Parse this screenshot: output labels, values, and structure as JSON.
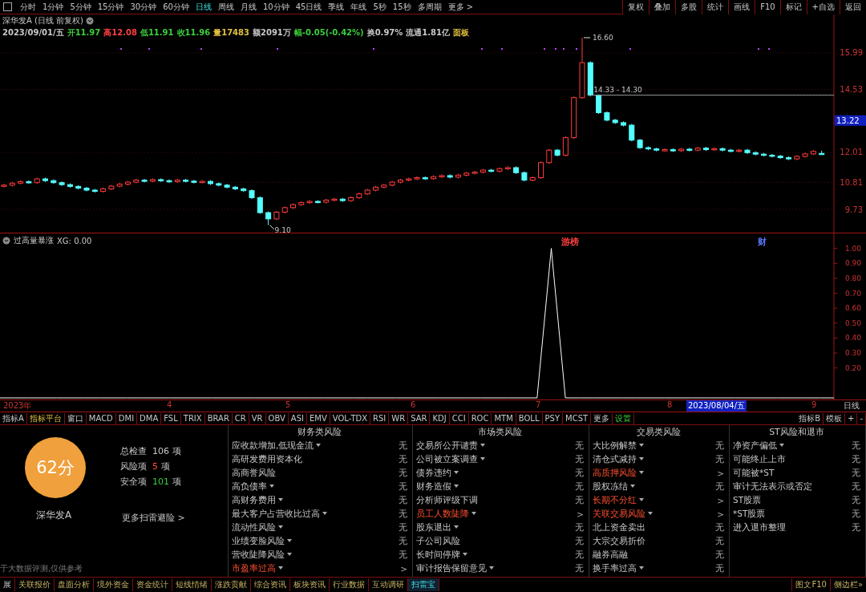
{
  "toolbar": {
    "periods": [
      {
        "label": "分时",
        "selected": false
      },
      {
        "label": "1分钟",
        "selected": false
      },
      {
        "label": "5分钟",
        "selected": false
      },
      {
        "label": "15分钟",
        "selected": false
      },
      {
        "label": "30分钟",
        "selected": false
      },
      {
        "label": "60分钟",
        "selected": false
      },
      {
        "label": "日线",
        "selected": true
      },
      {
        "label": "周线",
        "selected": false
      },
      {
        "label": "月线",
        "selected": false
      },
      {
        "label": "10分钟",
        "selected": false
      },
      {
        "label": "45日线",
        "selected": false
      },
      {
        "label": "季线",
        "selected": false
      },
      {
        "label": "年线",
        "selected": false
      },
      {
        "label": "5秒",
        "selected": false
      },
      {
        "label": "15秒",
        "selected": false
      },
      {
        "label": "多周期",
        "selected": false
      },
      {
        "label": "更多 >",
        "selected": false
      }
    ],
    "actions": [
      "复权",
      "叠加",
      "多股",
      "统计",
      "画线",
      "F10",
      "标记",
      "+自选",
      "返回"
    ]
  },
  "chart": {
    "title": "深华发A (日线 前复权)",
    "quote": [
      {
        "text": "2023/09/01/五",
        "color": "#c8c8c8"
      },
      {
        "text": "开11.97",
        "color": "#3ccd3c"
      },
      {
        "text": "高12.08",
        "color": "#ff4040"
      },
      {
        "text": "低11.91",
        "color": "#3ccd3c"
      },
      {
        "text": "收11.96",
        "color": "#3ccd3c"
      },
      {
        "text": "量17483",
        "color": "#e0c040"
      },
      {
        "text": "额2091万",
        "color": "#c8c8c8"
      },
      {
        "text": "幅-0.05(-0.42%)",
        "color": "#3ccd3c"
      },
      {
        "text": "换0.97%",
        "color": "#c8c8c8"
      },
      {
        "text": "流通1.81亿",
        "color": "#c8c8c8"
      },
      {
        "text": "面板",
        "color": "#e0c040"
      }
    ],
    "event_labels": [
      {
        "text": "游榜",
        "color": "#ff4040"
      },
      {
        "text": "财",
        "color": "#5a78ff"
      }
    ],
    "chart_data": {
      "type": "candlestick",
      "ylim": [
        8.8,
        17.53
      ],
      "yticks": [
        {
          "value": 15.99,
          "label": "15.99"
        },
        {
          "value": 14.53,
          "label": "14.53"
        },
        {
          "value": 12.01,
          "label": "12.01"
        },
        {
          "value": 10.81,
          "label": "10.81"
        },
        {
          "value": 9.73,
          "label": "9.73"
        }
      ],
      "grid": true,
      "annotations": [
        "16.60",
        "14.33 - 14.30",
        "9.10",
        "13.22"
      ],
      "ohlc": [
        [
          10.66,
          10.75,
          10.61,
          10.7
        ],
        [
          10.7,
          10.83,
          10.65,
          10.78
        ],
        [
          10.78,
          10.89,
          10.73,
          10.84
        ],
        [
          10.84,
          10.89,
          10.75,
          10.8
        ],
        [
          10.8,
          11.0,
          10.75,
          10.95
        ],
        [
          10.95,
          11.0,
          10.83,
          10.88
        ],
        [
          10.88,
          10.93,
          10.75,
          10.8
        ],
        [
          10.8,
          10.85,
          10.67,
          10.72
        ],
        [
          10.72,
          10.77,
          10.6,
          10.65
        ],
        [
          10.65,
          10.7,
          10.53,
          10.58
        ],
        [
          10.58,
          10.63,
          10.45,
          10.5
        ],
        [
          10.5,
          10.55,
          10.4,
          10.45
        ],
        [
          10.45,
          10.6,
          10.4,
          10.55
        ],
        [
          10.55,
          10.71,
          10.5,
          10.66
        ],
        [
          10.66,
          10.79,
          10.61,
          10.74
        ],
        [
          10.74,
          10.87,
          10.69,
          10.82
        ],
        [
          10.82,
          10.95,
          10.77,
          10.9
        ],
        [
          10.9,
          10.95,
          10.81,
          10.86
        ],
        [
          10.86,
          10.97,
          10.81,
          10.92
        ],
        [
          10.92,
          10.97,
          10.83,
          10.88
        ],
        [
          10.88,
          10.93,
          10.79,
          10.84
        ],
        [
          10.84,
          10.95,
          10.79,
          10.9
        ],
        [
          10.9,
          10.95,
          10.81,
          10.86
        ],
        [
          10.86,
          10.91,
          10.77,
          10.82
        ],
        [
          10.82,
          10.9,
          10.77,
          10.85
        ],
        [
          10.85,
          10.9,
          10.71,
          10.76
        ],
        [
          10.76,
          10.81,
          10.65,
          10.7
        ],
        [
          10.7,
          10.75,
          10.57,
          10.62
        ],
        [
          10.62,
          10.67,
          10.5,
          10.55
        ],
        [
          10.55,
          10.6,
          10.43,
          10.48
        ],
        [
          10.48,
          10.53,
          10.15,
          10.2
        ],
        [
          10.2,
          10.25,
          9.55,
          9.6
        ],
        [
          9.6,
          9.65,
          9.1,
          9.35
        ],
        [
          9.35,
          9.67,
          9.3,
          9.62
        ],
        [
          9.62,
          9.85,
          9.57,
          9.8
        ],
        [
          9.8,
          9.97,
          9.75,
          9.92
        ],
        [
          9.92,
          10.05,
          9.87,
          10.0
        ],
        [
          10.0,
          10.1,
          9.95,
          10.05
        ],
        [
          10.05,
          10.1,
          9.97,
          10.02
        ],
        [
          10.02,
          10.15,
          9.97,
          10.1
        ],
        [
          10.1,
          10.19,
          10.05,
          10.14
        ],
        [
          10.14,
          10.19,
          10.03,
          10.08
        ],
        [
          10.08,
          10.25,
          10.03,
          10.2
        ],
        [
          10.2,
          10.4,
          10.15,
          10.35
        ],
        [
          10.35,
          10.55,
          10.3,
          10.5
        ],
        [
          10.5,
          10.67,
          10.45,
          10.62
        ],
        [
          10.62,
          10.75,
          10.57,
          10.7
        ],
        [
          10.7,
          10.87,
          10.65,
          10.82
        ],
        [
          10.82,
          10.95,
          10.77,
          10.9
        ],
        [
          10.9,
          11.0,
          10.85,
          10.95
        ],
        [
          10.95,
          11.05,
          10.9,
          11.0
        ],
        [
          11.0,
          11.05,
          10.91,
          10.96
        ],
        [
          10.96,
          11.09,
          10.91,
          11.04
        ],
        [
          11.04,
          11.13,
          10.99,
          11.08
        ],
        [
          11.08,
          11.13,
          10.97,
          11.02
        ],
        [
          11.02,
          11.15,
          10.97,
          11.1
        ],
        [
          11.1,
          11.23,
          11.05,
          11.18
        ],
        [
          11.18,
          11.27,
          11.13,
          11.22
        ],
        [
          11.22,
          11.35,
          11.17,
          11.3
        ],
        [
          11.3,
          11.35,
          11.21,
          11.26
        ],
        [
          11.26,
          11.41,
          11.21,
          11.36
        ],
        [
          11.36,
          11.45,
          11.31,
          11.4
        ],
        [
          11.4,
          11.45,
          11.15,
          11.2
        ],
        [
          11.2,
          11.25,
          10.85,
          10.9
        ],
        [
          10.9,
          11.05,
          10.85,
          11.0
        ],
        [
          11.0,
          11.65,
          10.95,
          11.6
        ],
        [
          11.6,
          12.15,
          11.55,
          12.1
        ],
        [
          12.1,
          12.15,
          11.85,
          11.9
        ],
        [
          11.9,
          12.65,
          11.85,
          12.6
        ],
        [
          12.6,
          14.25,
          12.55,
          14.2
        ],
        [
          14.2,
          16.6,
          14.15,
          15.6
        ],
        [
          15.6,
          15.65,
          14.25,
          14.3
        ],
        [
          14.3,
          14.33,
          13.55,
          13.6
        ],
        [
          13.6,
          13.65,
          13.25,
          13.3
        ],
        [
          13.3,
          13.35,
          13.15,
          13.2
        ],
        [
          13.2,
          13.25,
          13.05,
          13.1
        ],
        [
          13.1,
          13.15,
          12.45,
          12.5
        ],
        [
          12.5,
          12.55,
          12.15,
          12.2
        ],
        [
          12.2,
          12.25,
          12.1,
          12.15
        ],
        [
          12.15,
          12.2,
          12.05,
          12.1
        ],
        [
          12.1,
          12.17,
          12.05,
          12.12
        ],
        [
          12.12,
          12.17,
          12.03,
          12.08
        ],
        [
          12.08,
          12.19,
          12.03,
          12.14
        ],
        [
          12.14,
          12.19,
          12.05,
          12.1
        ],
        [
          12.1,
          12.23,
          12.05,
          12.18
        ],
        [
          12.18,
          12.23,
          12.07,
          12.12
        ],
        [
          12.12,
          12.21,
          12.07,
          12.16
        ],
        [
          12.16,
          12.21,
          12.05,
          12.1
        ],
        [
          12.1,
          12.15,
          12.01,
          12.06
        ],
        [
          12.06,
          12.15,
          12.01,
          12.1
        ],
        [
          12.1,
          12.15,
          11.95,
          12.0
        ],
        [
          12.0,
          12.05,
          11.89,
          11.94
        ],
        [
          11.94,
          11.99,
          11.85,
          11.9
        ],
        [
          11.9,
          11.95,
          11.81,
          11.86
        ],
        [
          11.86,
          11.91,
          11.75,
          11.8
        ],
        [
          11.8,
          11.85,
          11.7,
          11.75
        ],
        [
          11.75,
          11.9,
          11.7,
          11.85
        ],
        [
          11.85,
          12.0,
          11.8,
          11.95
        ],
        [
          11.95,
          12.1,
          11.9,
          12.05
        ],
        [
          11.97,
          12.08,
          11.91,
          11.96
        ]
      ]
    }
  },
  "indicator": {
    "title": "过高量暴涨",
    "reading": ": 0.00",
    "chart_data": {
      "type": "line",
      "ylim": [
        0,
        1.1
      ],
      "yticks": [
        {
          "value": 1,
          "label": "1.00"
        },
        {
          "value": 0.9,
          "label": "0.90"
        },
        {
          "value": 0.8,
          "label": "0.80"
        },
        {
          "value": 0.7,
          "label": "0.70"
        },
        {
          "value": 0.6,
          "label": "0.60"
        },
        {
          "value": 0.5,
          "label": "0.50"
        },
        {
          "value": 0.4,
          "label": "0.40"
        },
        {
          "value": 0.3,
          "label": "0.30"
        },
        {
          "value": 0.2,
          "label": "0.20"
        }
      ],
      "series": [
        {
          "name": "XG",
          "color": "#ffffff",
          "values": [
            0,
            0,
            0,
            0,
            0,
            0,
            0,
            0,
            0,
            0,
            0,
            0,
            0,
            0,
            0,
            0,
            0,
            0,
            0,
            0,
            0,
            0,
            0,
            0,
            0,
            0,
            0,
            0,
            0,
            0,
            0,
            0,
            0,
            0,
            0,
            0,
            0,
            0,
            0,
            1,
            0,
            0,
            0,
            0,
            0,
            0,
            0,
            0,
            0,
            0,
            0,
            0,
            0,
            0,
            0,
            0,
            0,
            0,
            0,
            0
          ]
        }
      ]
    }
  },
  "x_axis": {
    "labels": [
      "2023年",
      "4",
      "5",
      "6",
      "7",
      "8",
      "9"
    ],
    "cursor_date": "2023/08/04/五",
    "period": "日线"
  },
  "indicator_tabs": {
    "left": [
      {
        "label": "指标A",
        "kind": "plain"
      },
      {
        "label": "指标平台",
        "kind": "platform"
      },
      {
        "label": "窗口",
        "kind": "plain"
      },
      {
        "label": "MACD",
        "kind": "plain"
      },
      {
        "label": "DMI",
        "kind": "plain"
      },
      {
        "label": "DMA",
        "kind": "plain"
      },
      {
        "label": "FSL",
        "kind": "plain"
      },
      {
        "label": "TRIX",
        "kind": "plain"
      },
      {
        "label": "BRAR",
        "kind": "plain"
      },
      {
        "label": "CR",
        "kind": "plain"
      },
      {
        "label": "VR",
        "kind": "plain"
      },
      {
        "label": "OBV",
        "kind": "plain"
      },
      {
        "label": "ASI",
        "kind": "plain"
      },
      {
        "label": "EMV",
        "kind": "plain"
      },
      {
        "label": "VOL-TDX",
        "kind": "plain"
      },
      {
        "label": "RSI",
        "kind": "plain"
      },
      {
        "label": "WR",
        "kind": "plain"
      },
      {
        "label": "SAR",
        "kind": "plain"
      },
      {
        "label": "KDJ",
        "kind": "plain"
      },
      {
        "label": "CCI",
        "kind": "plain"
      },
      {
        "label": "ROC",
        "kind": "plain"
      },
      {
        "label": "MTM",
        "kind": "plain"
      },
      {
        "label": "BOLL",
        "kind": "plain"
      },
      {
        "label": "PSY",
        "kind": "plain"
      },
      {
        "label": "MCST",
        "kind": "plain"
      },
      {
        "label": "更多",
        "kind": "plain"
      },
      {
        "label": "设置",
        "kind": "settings"
      }
    ],
    "right": [
      "指标B",
      "模板",
      "+",
      "-"
    ]
  },
  "risk_panel": {
    "score": "62分",
    "stock": "深华发A",
    "stats": [
      {
        "label": "总检查",
        "value": "106",
        "unit": "项",
        "kind": "total"
      },
      {
        "label": "风险项",
        "value": "5",
        "unit": "项",
        "kind": "risk"
      },
      {
        "label": "安全项",
        "value": "101",
        "unit": "项",
        "kind": "safe"
      }
    ],
    "more_link": "更多扫雷避险 >",
    "footnote": "于大数据评测,仅供参考",
    "columns": [
      {
        "title": "财务类风险",
        "rows": [
          {
            "name": "应收款增加,低现金流",
            "expandable": true,
            "risk": false,
            "status": "无"
          },
          {
            "name": "高研发费用资本化",
            "expandable": false,
            "risk": false,
            "status": "无"
          },
          {
            "name": "高商誉风险",
            "expandable": false,
            "risk": false,
            "status": "无"
          },
          {
            "name": "高负债率",
            "expandable": true,
            "risk": false,
            "status": "无"
          },
          {
            "name": "高财务费用",
            "expandable": true,
            "risk": false,
            "status": "无"
          },
          {
            "name": "最大客户占营收比过高",
            "expandable": true,
            "risk": false,
            "status": "无"
          },
          {
            "name": "流动性风险",
            "expandable": true,
            "risk": false,
            "status": "无"
          },
          {
            "name": "业绩变脸风险",
            "expandable": true,
            "risk": false,
            "status": "无"
          },
          {
            "name": "营收陡降风险",
            "expandable": true,
            "risk": false,
            "status": "无"
          },
          {
            "name": "市盈率过高",
            "expandable": true,
            "risk": true,
            "status": ">"
          }
        ]
      },
      {
        "title": "市场类风险",
        "rows": [
          {
            "name": "交易所公开谴责",
            "expandable": true,
            "risk": false,
            "status": "无"
          },
          {
            "name": "公司被立案调查",
            "expandable": true,
            "risk": false,
            "status": "无"
          },
          {
            "name": "债券违约",
            "expandable": true,
            "risk": false,
            "status": "无"
          },
          {
            "name": "财务造假",
            "expandable": true,
            "risk": false,
            "status": "无"
          },
          {
            "name": "分析师评级下调",
            "expandable": false,
            "risk": false,
            "status": "无"
          },
          {
            "name": "员工人数陡降",
            "expandable": true,
            "risk": true,
            "status": ">"
          },
          {
            "name": "股东退出",
            "expandable": true,
            "risk": false,
            "status": "无"
          },
          {
            "name": "子公司风险",
            "expandable": false,
            "risk": false,
            "status": "无"
          },
          {
            "name": "长时间停牌",
            "expandable": true,
            "risk": false,
            "status": "无"
          },
          {
            "name": "审计报告保留意见",
            "expandable": true,
            "risk": false,
            "status": "无"
          }
        ]
      },
      {
        "title": "交易类风险",
        "rows": [
          {
            "name": "大比例解禁",
            "expandable": true,
            "risk": false,
            "status": "无"
          },
          {
            "name": "清仓式减持",
            "expandable": true,
            "risk": false,
            "status": "无"
          },
          {
            "name": "高质押风险",
            "expandable": true,
            "risk": true,
            "status": ">"
          },
          {
            "name": "股权冻结",
            "expandable": true,
            "risk": false,
            "status": "无"
          },
          {
            "name": "长期不分红",
            "expandable": true,
            "risk": true,
            "status": ">"
          },
          {
            "name": "关联交易风险",
            "expandable": true,
            "risk": true,
            "status": ">"
          },
          {
            "name": "北上资金卖出",
            "expandable": false,
            "risk": false,
            "status": "无"
          },
          {
            "name": "大宗交易折价",
            "expandable": false,
            "risk": false,
            "status": "无"
          },
          {
            "name": "融券高融",
            "expandable": false,
            "risk": false,
            "status": "无"
          },
          {
            "name": "换手率过高",
            "expandable": true,
            "risk": false,
            "status": "无"
          }
        ]
      },
      {
        "title": "ST风险和退市",
        "rows": [
          {
            "name": "净资产偏低",
            "expandable": true,
            "risk": false,
            "status": "无"
          },
          {
            "name": "可能终止上市",
            "expandable": false,
            "risk": false,
            "status": "无"
          },
          {
            "name": "可能被*ST",
            "expandable": false,
            "risk": false,
            "status": "无"
          },
          {
            "name": "审计无法表示或否定",
            "expandable": false,
            "risk": false,
            "status": "无"
          },
          {
            "name": "ST股票",
            "expandable": false,
            "risk": false,
            "status": "无"
          },
          {
            "name": "*ST股票",
            "expandable": false,
            "risk": false,
            "status": "无"
          },
          {
            "name": "进入退市整理",
            "expandable": false,
            "risk": false,
            "status": "无"
          }
        ]
      }
    ]
  },
  "bottom_tabs": {
    "items": [
      {
        "label": "展",
        "selected": false
      },
      {
        "label": "关联报价",
        "selected": false
      },
      {
        "label": "盘面分析",
        "selected": false
      },
      {
        "label": "境外资金",
        "selected": false
      },
      {
        "label": "资金统计",
        "selected": false
      },
      {
        "label": "短线情绪",
        "selected": false
      },
      {
        "label": "涨跌贡献",
        "selected": false
      },
      {
        "label": "综合资讯",
        "selected": false
      },
      {
        "label": "板块资讯",
        "selected": false
      },
      {
        "label": "行业数据",
        "selected": false
      },
      {
        "label": "互动调研",
        "selected": false
      },
      {
        "label": "扫雷宝",
        "selected": true
      }
    ],
    "right": [
      "图文F10",
      "侧边栏»"
    ]
  }
}
